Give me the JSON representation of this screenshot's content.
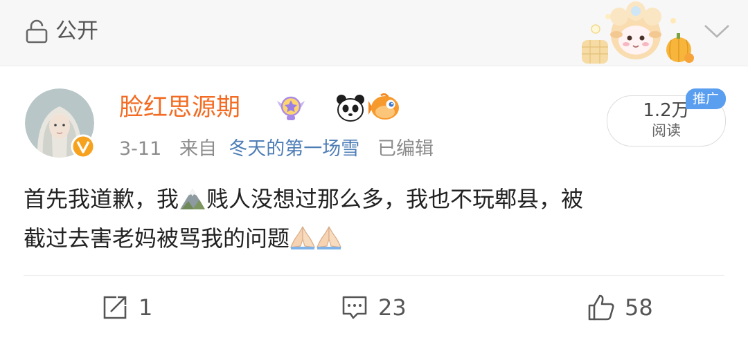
{
  "header": {
    "privacy_label": "公开",
    "privacy_icon": "lock-icon",
    "collapse_icon": "chevron-down-icon"
  },
  "post": {
    "author": {
      "name": "脸红思源期",
      "verified": true
    },
    "meta": {
      "date": "3-11",
      "from_label": "来自",
      "source": "冬天的第一场雪",
      "edited": "已编辑"
    },
    "views": {
      "count": "1.2万",
      "label": "阅读"
    },
    "promo_tag": "推广",
    "body_line1_a": "首先我道歉，我",
    "body_line1_b": "贱人没想过那么多，我也不玩郫县，被",
    "body_line2": "截过去害老妈被骂我的问题"
  },
  "actions": {
    "repost": "1",
    "comment": "23",
    "like": "58"
  },
  "colors": {
    "username": "#f36b22",
    "source_link": "#4e7db6",
    "promo": "#5a9ef0"
  }
}
